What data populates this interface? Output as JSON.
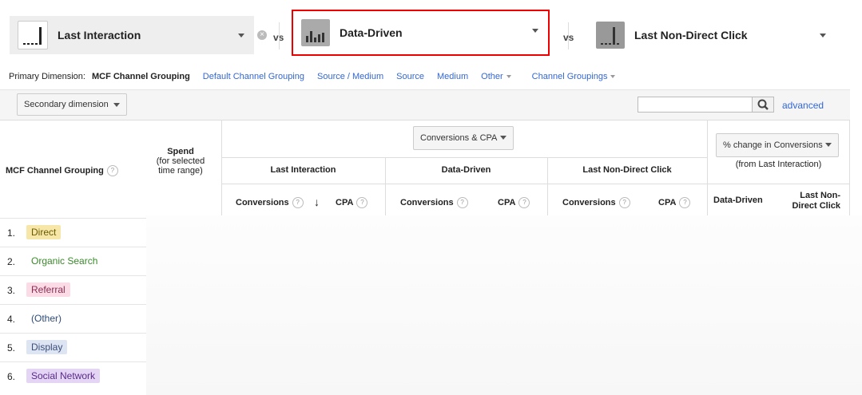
{
  "models": {
    "first": {
      "name": "Last Interaction",
      "icon": "model-bars-icon"
    },
    "second": {
      "name": "Data-Driven",
      "icon": "model-bars-icon"
    },
    "third": {
      "name": "Last Non-Direct Click",
      "icon": "model-bars-icon"
    },
    "vs_label": "vs",
    "clear_symbol": "×"
  },
  "dimensions": {
    "primary_label": "Primary Dimension:",
    "selected": "MCF Channel Grouping",
    "links": [
      "Default Channel Grouping",
      "Source / Medium",
      "Source",
      "Medium",
      "Other",
      "Channel Groupings"
    ]
  },
  "toolbar": {
    "secondary_dimension": "Secondary dimension",
    "search_placeholder": "",
    "advanced": "advanced"
  },
  "table": {
    "dimension_header": "MCF Channel Grouping",
    "spend_header": "Spend",
    "spend_sub1": "(for selected",
    "spend_sub2": "time range)",
    "metric_select": "Conversions & CPA",
    "change_select": "% change in Conversions",
    "change_sub": "(from Last Interaction)",
    "groups": [
      "Last Interaction",
      "Data-Driven",
      "Last Non-Direct Click"
    ],
    "conversions": "Conversions",
    "cpa": "CPA",
    "sort_arrow": "↓",
    "change_cols": [
      "Data-Driven",
      "Last Non-Direct Click"
    ],
    "change_col2_line1": "Last Non-",
    "change_col2_line2": "Direct Click",
    "help": "?"
  },
  "rows": [
    {
      "n": "1.",
      "label": "Direct",
      "bg": "#f6e7a8",
      "fg": "#6b5a00"
    },
    {
      "n": "2.",
      "label": "Organic Search",
      "bg": "#ffffff",
      "fg": "#3a8a2a"
    },
    {
      "n": "3.",
      "label": "Referral",
      "bg": "#fadbe6",
      "fg": "#8b2d52"
    },
    {
      "n": "4.",
      "label": "(Other)",
      "bg": "#ffffff",
      "fg": "#2d4b7a"
    },
    {
      "n": "5.",
      "label": "Display",
      "bg": "#dde4f2",
      "fg": "#3a4f7a"
    },
    {
      "n": "6.",
      "label": "Social Network",
      "bg": "#e4d5f5",
      "fg": "#5a2a8a"
    }
  ]
}
